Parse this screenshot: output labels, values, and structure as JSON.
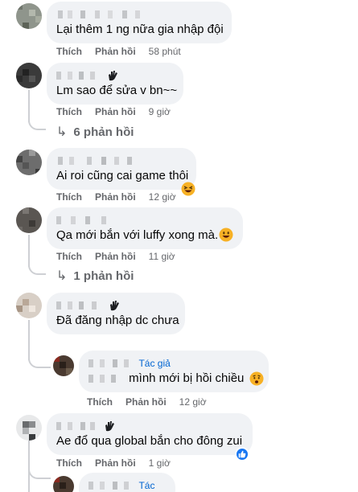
{
  "actions": {
    "like": "Thích",
    "reply": "Phản hồi"
  },
  "colors": {
    "bubble": "#f0f2f5",
    "meta": "#65676b",
    "author": "#0064d1",
    "like_badge": "#1877f2"
  },
  "comments": [
    {
      "text": "Lại thêm 1 ng nữa gia nhập đội",
      "time": "58 phút"
    },
    {
      "text": "Lm sao để sửa v bn~~",
      "time": "9 giờ",
      "replies": "6 phản hồi",
      "badge_icon": "wave-icon"
    },
    {
      "text": "Ai roi cũng cai game thôi",
      "time": "12 giờ",
      "emoji": "laughing-emoji"
    },
    {
      "text": "Qa mới bắn với luffy xong mà.",
      "time": "11 giờ",
      "replies": "1 phản hồi",
      "emoji": "grinning-emoji"
    },
    {
      "text": "Đã đăng nhập dc chưa",
      "time": "",
      "badge_icon": "wave-icon"
    },
    {
      "author_tag": "Tác giả",
      "text": "mình mới bị hồi chiều",
      "time": "12 giờ",
      "emoji": "sad-emoji"
    },
    {
      "text": "Ae đổ qua global bắn cho đông zui",
      "time": "1 giờ",
      "reaction": "like-reaction",
      "badge_icon": "wave-icon"
    },
    {
      "author_tag": "Tác giả"
    }
  ]
}
